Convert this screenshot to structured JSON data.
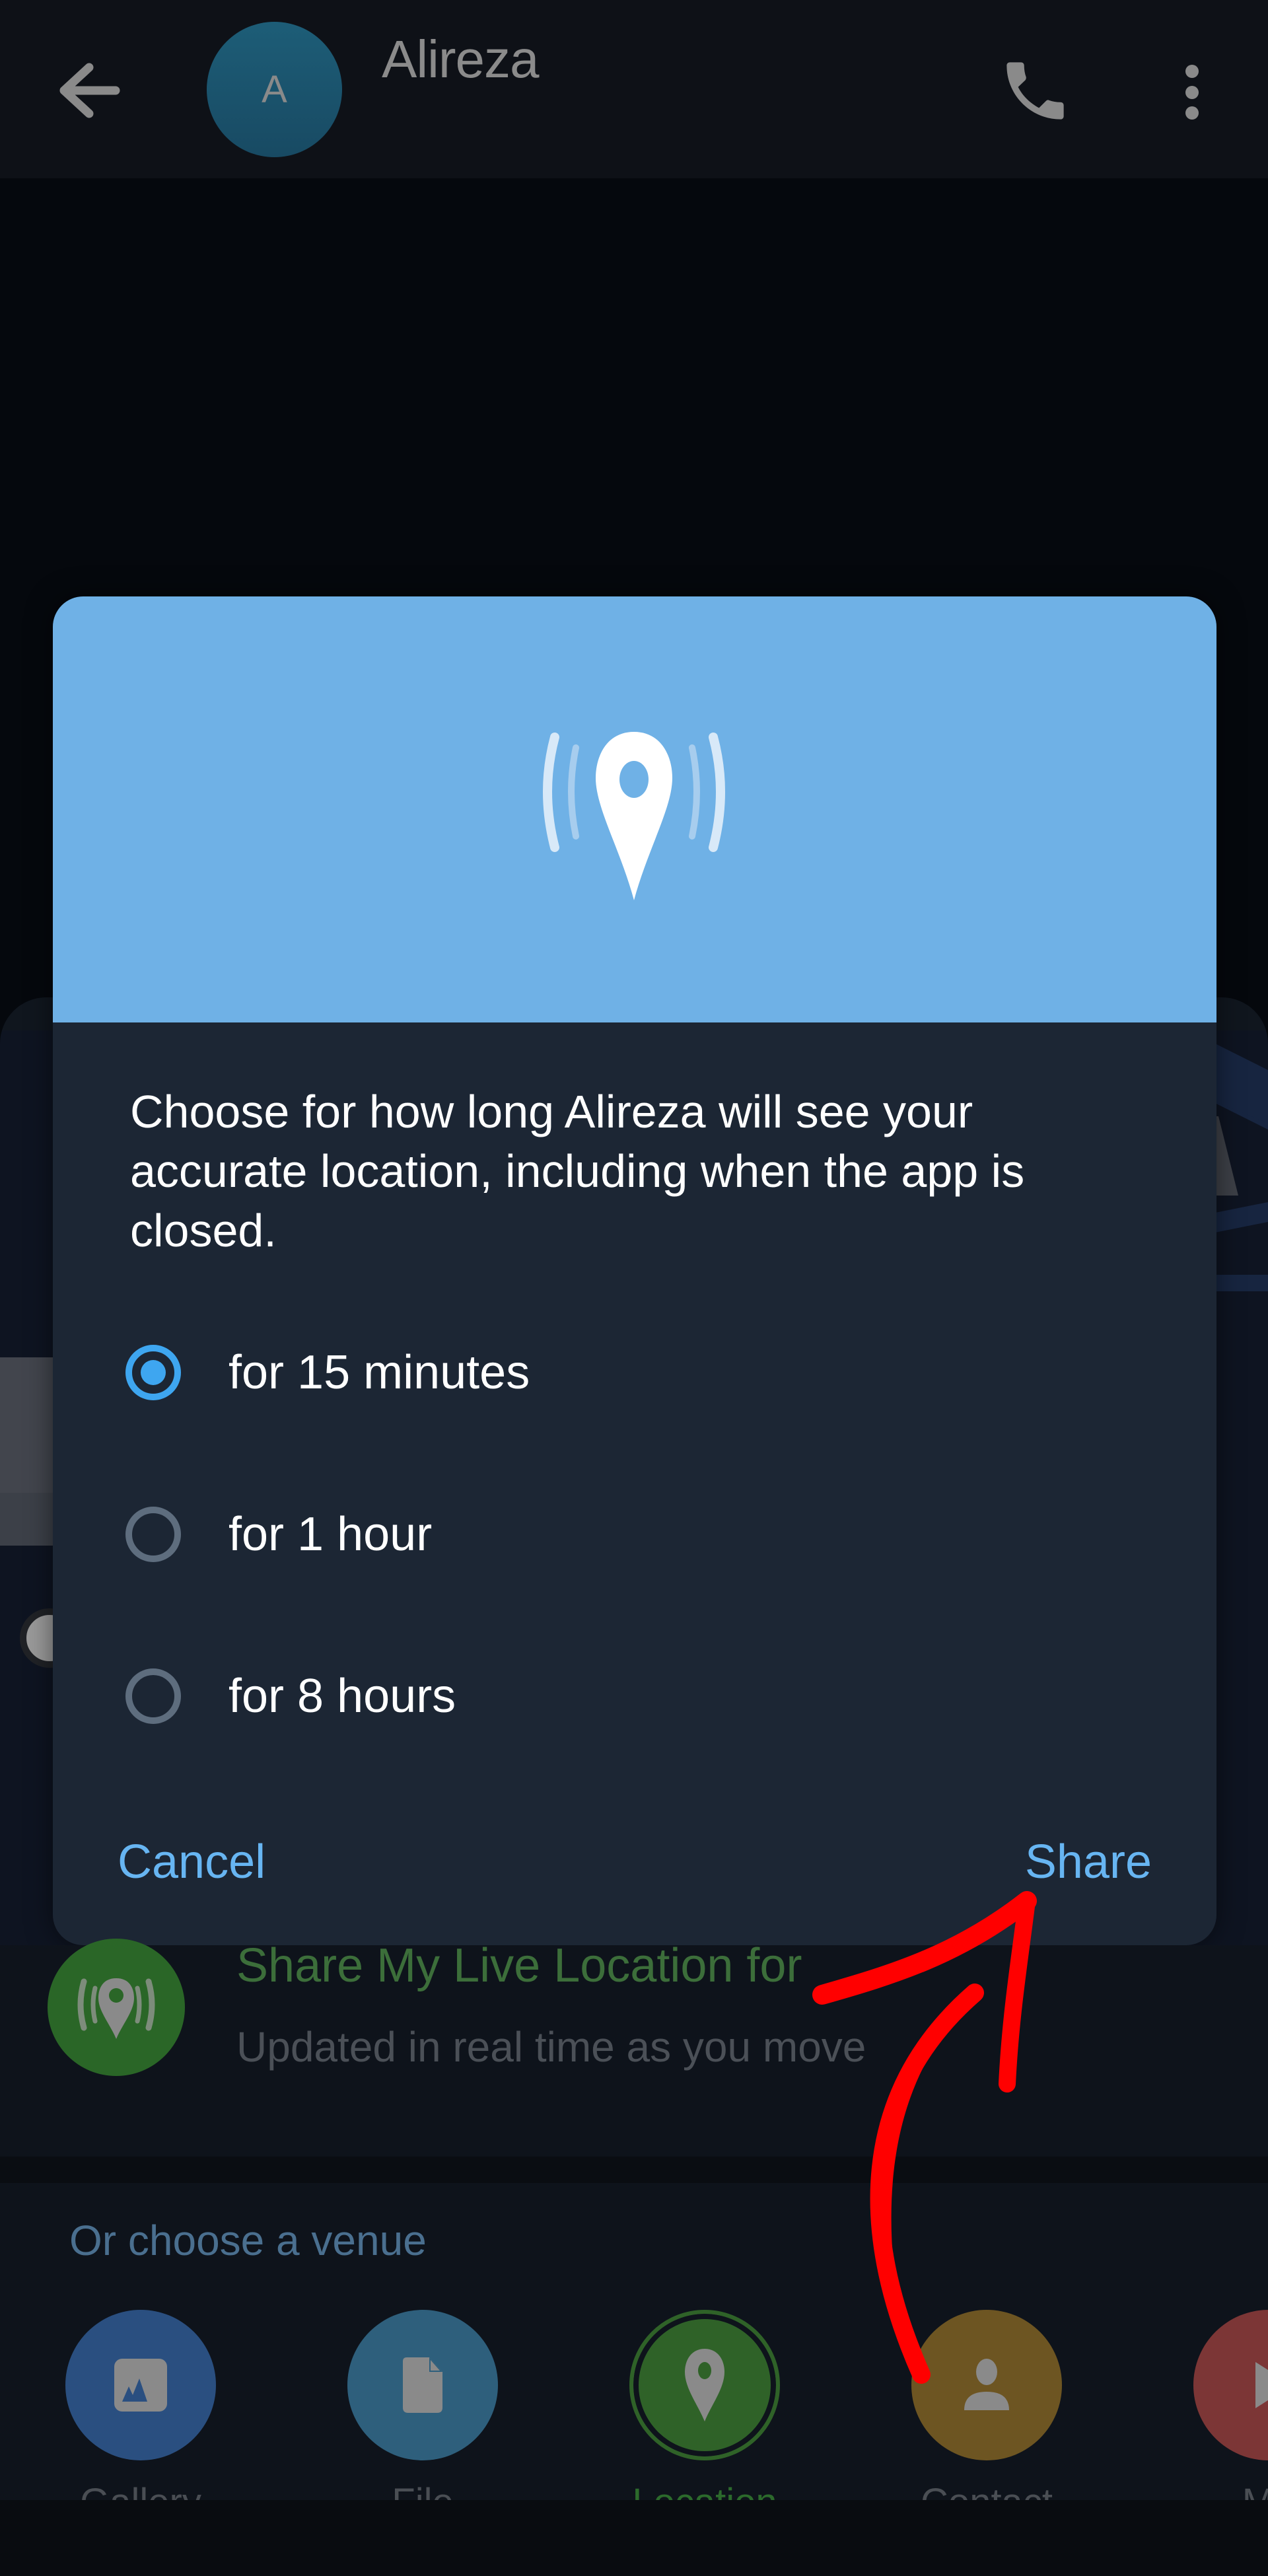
{
  "header": {
    "title": "Alireza",
    "avatar_initial": "A",
    "icons": {
      "back": "arrow-left-icon",
      "call": "phone-icon",
      "menu": "more-vert-icon"
    }
  },
  "dialog": {
    "header_icon": "live-location-icon",
    "message": "Choose for how long Alireza will see your accurate location, including when the app is closed.",
    "options": [
      {
        "label": "for 15 minutes",
        "selected": true
      },
      {
        "label": "for 1 hour",
        "selected": false
      },
      {
        "label": "for 8 hours",
        "selected": false
      }
    ],
    "cancel_label": "Cancel",
    "share_label": "Share",
    "colors": {
      "header_bg": "#6fb1e6",
      "accent": "#3ea6f0",
      "button_text": "#67b5f2",
      "body_bg": "#1c2634"
    }
  },
  "live_location": {
    "title": "Share My Live Location for",
    "subtitle": "Updated in real time as you move",
    "icon": "live-location-icon",
    "color": "#2a6627"
  },
  "venue_header": "Or choose a venue",
  "attach_tabs": [
    {
      "label": "Gallery",
      "icon": "gallery-icon",
      "color": "#2a4f80",
      "active": false
    },
    {
      "label": "File",
      "icon": "file-icon",
      "color": "#2e5f7c",
      "active": false
    },
    {
      "label": "Location",
      "icon": "location-pin-icon",
      "color": "#2f6228",
      "active": true
    },
    {
      "label": "Contact",
      "icon": "contact-icon",
      "color": "#6d5522",
      "active": false
    },
    {
      "label": "Mu",
      "icon": "music-icon",
      "color": "#7c3636",
      "active": false
    }
  ],
  "annotation": {
    "type": "red-arrow",
    "from": "Contact",
    "to": "Share",
    "color": "#ff0000"
  }
}
